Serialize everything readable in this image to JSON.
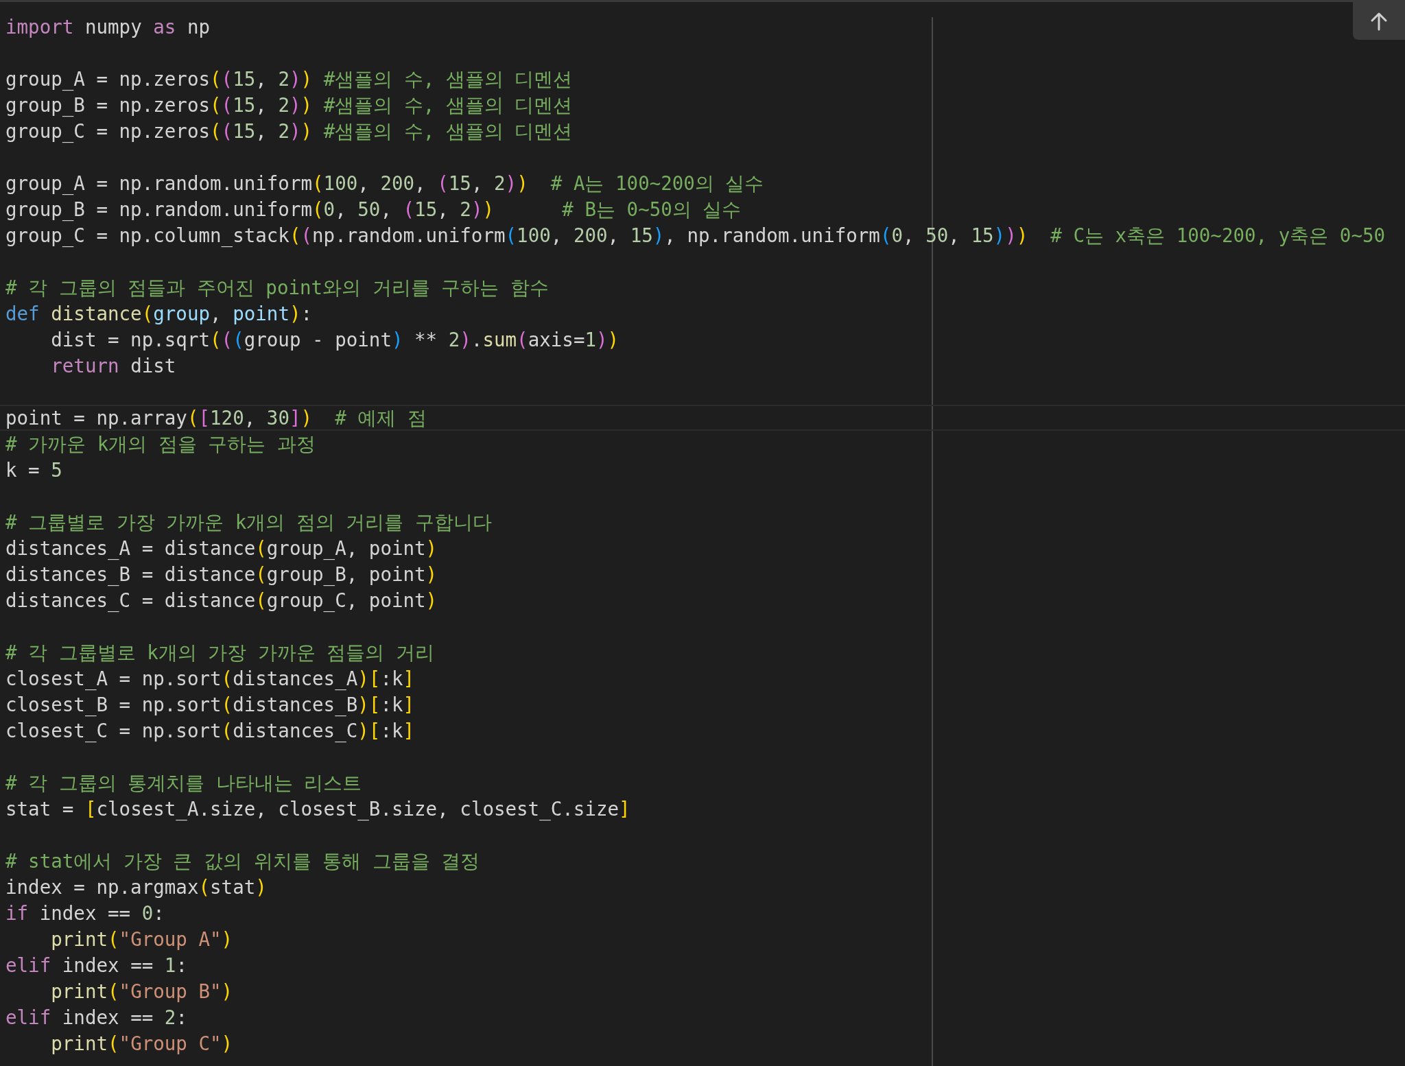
{
  "code": {
    "blocks": [
      {
        "lines": [
          {
            "current": false,
            "tokens": [
              {
                "text": "import",
                "kind": "kw"
              },
              {
                "text": " numpy ",
                "kind": "plain"
              },
              {
                "text": "as",
                "kind": "kw"
              },
              {
                "text": " np",
                "kind": "plain"
              }
            ]
          }
        ]
      },
      {
        "lines": [
          {
            "current": false,
            "tokens": [
              {
                "text": "group_A = np.zeros",
                "kind": "plain"
              },
              {
                "text": "(",
                "kind": "b1"
              },
              {
                "text": "(",
                "kind": "b2"
              },
              {
                "text": "15",
                "kind": "num"
              },
              {
                "text": ", ",
                "kind": "plain"
              },
              {
                "text": "2",
                "kind": "num"
              },
              {
                "text": ")",
                "kind": "b2"
              },
              {
                "text": ")",
                "kind": "b1"
              },
              {
                "text": " #샘플의 수, 샘플의 디멘션",
                "kind": "cm"
              }
            ]
          },
          {
            "current": false,
            "tokens": [
              {
                "text": "group_B = np.zeros",
                "kind": "plain"
              },
              {
                "text": "(",
                "kind": "b1"
              },
              {
                "text": "(",
                "kind": "b2"
              },
              {
                "text": "15",
                "kind": "num"
              },
              {
                "text": ", ",
                "kind": "plain"
              },
              {
                "text": "2",
                "kind": "num"
              },
              {
                "text": ")",
                "kind": "b2"
              },
              {
                "text": ")",
                "kind": "b1"
              },
              {
                "text": " #샘플의 수, 샘플의 디멘션",
                "kind": "cm"
              }
            ]
          },
          {
            "current": false,
            "tokens": [
              {
                "text": "group_C = np.zeros",
                "kind": "plain"
              },
              {
                "text": "(",
                "kind": "b1"
              },
              {
                "text": "(",
                "kind": "b2"
              },
              {
                "text": "15",
                "kind": "num"
              },
              {
                "text": ", ",
                "kind": "plain"
              },
              {
                "text": "2",
                "kind": "num"
              },
              {
                "text": ")",
                "kind": "b2"
              },
              {
                "text": ")",
                "kind": "b1"
              },
              {
                "text": " #샘플의 수, 샘플의 디멘션",
                "kind": "cm"
              }
            ]
          }
        ]
      },
      {
        "lines": [
          {
            "current": false,
            "tokens": [
              {
                "text": "group_A = np.random.uniform",
                "kind": "plain"
              },
              {
                "text": "(",
                "kind": "b1"
              },
              {
                "text": "100",
                "kind": "num"
              },
              {
                "text": ", ",
                "kind": "plain"
              },
              {
                "text": "200",
                "kind": "num"
              },
              {
                "text": ", ",
                "kind": "plain"
              },
              {
                "text": "(",
                "kind": "b2"
              },
              {
                "text": "15",
                "kind": "num"
              },
              {
                "text": ", ",
                "kind": "plain"
              },
              {
                "text": "2",
                "kind": "num"
              },
              {
                "text": ")",
                "kind": "b2"
              },
              {
                "text": ")",
                "kind": "b1"
              },
              {
                "text": "  # A는 100~200의 실수",
                "kind": "cm"
              }
            ]
          },
          {
            "current": false,
            "tokens": [
              {
                "text": "group_B = np.random.uniform",
                "kind": "plain"
              },
              {
                "text": "(",
                "kind": "b1"
              },
              {
                "text": "0",
                "kind": "num"
              },
              {
                "text": ", ",
                "kind": "plain"
              },
              {
                "text": "50",
                "kind": "num"
              },
              {
                "text": ", ",
                "kind": "plain"
              },
              {
                "text": "(",
                "kind": "b2"
              },
              {
                "text": "15",
                "kind": "num"
              },
              {
                "text": ", ",
                "kind": "plain"
              },
              {
                "text": "2",
                "kind": "num"
              },
              {
                "text": ")",
                "kind": "b2"
              },
              {
                "text": ")",
                "kind": "b1"
              },
              {
                "text": "      # B는 0~50의 실수",
                "kind": "cm"
              }
            ]
          },
          {
            "current": false,
            "tokens": [
              {
                "text": "group_C = np.column_stack",
                "kind": "plain"
              },
              {
                "text": "(",
                "kind": "b1"
              },
              {
                "text": "(",
                "kind": "b2"
              },
              {
                "text": "np.random.uniform",
                "kind": "plain"
              },
              {
                "text": "(",
                "kind": "b3"
              },
              {
                "text": "100",
                "kind": "num"
              },
              {
                "text": ", ",
                "kind": "plain"
              },
              {
                "text": "200",
                "kind": "num"
              },
              {
                "text": ", ",
                "kind": "plain"
              },
              {
                "text": "15",
                "kind": "num"
              },
              {
                "text": ")",
                "kind": "b3"
              },
              {
                "text": ", np.random.uniform",
                "kind": "plain"
              },
              {
                "text": "(",
                "kind": "b3"
              },
              {
                "text": "0",
                "kind": "num"
              },
              {
                "text": ", ",
                "kind": "plain"
              },
              {
                "text": "50",
                "kind": "num"
              },
              {
                "text": ", ",
                "kind": "plain"
              },
              {
                "text": "15",
                "kind": "num"
              },
              {
                "text": ")",
                "kind": "b3"
              },
              {
                "text": ")",
                "kind": "b2"
              },
              {
                "text": ")",
                "kind": "b1"
              },
              {
                "text": "  # C는 x축은 100~200, y축은 0~50",
                "kind": "cm"
              }
            ]
          }
        ]
      },
      {
        "lines": [
          {
            "current": false,
            "tokens": [
              {
                "text": "# 각 그룹의 점들과 주어진 point와의 거리를 구하는 함수",
                "kind": "cm"
              }
            ]
          },
          {
            "current": false,
            "tokens": [
              {
                "text": "def",
                "kind": "def"
              },
              {
                "text": " distance",
                "kind": "fn"
              },
              {
                "text": "(",
                "kind": "b1"
              },
              {
                "text": "group",
                "kind": "param"
              },
              {
                "text": ", ",
                "kind": "plain"
              },
              {
                "text": "point",
                "kind": "param"
              },
              {
                "text": ")",
                "kind": "b1"
              },
              {
                "text": ":",
                "kind": "plain"
              }
            ]
          },
          {
            "current": false,
            "tokens": [
              {
                "text": "    dist = np.sqrt",
                "kind": "plain"
              },
              {
                "text": "(",
                "kind": "b1"
              },
              {
                "text": "(",
                "kind": "b2"
              },
              {
                "text": "(",
                "kind": "b3"
              },
              {
                "text": "group - point",
                "kind": "plain"
              },
              {
                "text": ")",
                "kind": "b3"
              },
              {
                "text": " ** ",
                "kind": "plain"
              },
              {
                "text": "2",
                "kind": "num"
              },
              {
                "text": ")",
                "kind": "b2"
              },
              {
                "text": ".",
                "kind": "plain"
              },
              {
                "text": "sum",
                "kind": "fn"
              },
              {
                "text": "(",
                "kind": "b2"
              },
              {
                "text": "axis=",
                "kind": "plain"
              },
              {
                "text": "1",
                "kind": "num"
              },
              {
                "text": ")",
                "kind": "b2"
              },
              {
                "text": ")",
                "kind": "b1"
              }
            ]
          },
          {
            "current": false,
            "tokens": [
              {
                "text": "    return",
                "kind": "kw"
              },
              {
                "text": " dist",
                "kind": "plain"
              }
            ]
          }
        ]
      },
      {
        "lines": [
          {
            "current": true,
            "tokens": [
              {
                "text": "point = np.array",
                "kind": "plain"
              },
              {
                "text": "(",
                "kind": "b1"
              },
              {
                "text": "[",
                "kind": "b2"
              },
              {
                "text": "120",
                "kind": "num"
              },
              {
                "text": ", ",
                "kind": "plain"
              },
              {
                "text": "30",
                "kind": "num"
              },
              {
                "text": "]",
                "kind": "b2"
              },
              {
                "text": ")",
                "kind": "b1"
              },
              {
                "text": "  # 예제 점",
                "kind": "cm"
              }
            ]
          },
          {
            "current": false,
            "tokens": [
              {
                "text": "# 가까운 k개의 점을 구하는 과정",
                "kind": "cm"
              }
            ]
          },
          {
            "current": false,
            "tokens": [
              {
                "text": "k = ",
                "kind": "plain"
              },
              {
                "text": "5",
                "kind": "num"
              }
            ]
          }
        ]
      },
      {
        "lines": [
          {
            "current": false,
            "tokens": [
              {
                "text": "# 그룹별로 가장 가까운 k개의 점의 거리를 구합니다",
                "kind": "cm"
              }
            ]
          },
          {
            "current": false,
            "tokens": [
              {
                "text": "distances_A = distance",
                "kind": "plain"
              },
              {
                "text": "(",
                "kind": "b1"
              },
              {
                "text": "group_A, point",
                "kind": "plain"
              },
              {
                "text": ")",
                "kind": "b1"
              }
            ]
          },
          {
            "current": false,
            "tokens": [
              {
                "text": "distances_B = distance",
                "kind": "plain"
              },
              {
                "text": "(",
                "kind": "b1"
              },
              {
                "text": "group_B, point",
                "kind": "plain"
              },
              {
                "text": ")",
                "kind": "b1"
              }
            ]
          },
          {
            "current": false,
            "tokens": [
              {
                "text": "distances_C = distance",
                "kind": "plain"
              },
              {
                "text": "(",
                "kind": "b1"
              },
              {
                "text": "group_C, point",
                "kind": "plain"
              },
              {
                "text": ")",
                "kind": "b1"
              }
            ]
          }
        ]
      },
      {
        "lines": [
          {
            "current": false,
            "tokens": [
              {
                "text": "# 각 그룹별로 k개의 가장 가까운 점들의 거리",
                "kind": "cm"
              }
            ]
          },
          {
            "current": false,
            "tokens": [
              {
                "text": "closest_A = np.sort",
                "kind": "plain"
              },
              {
                "text": "(",
                "kind": "b1"
              },
              {
                "text": "distances_A",
                "kind": "plain"
              },
              {
                "text": ")",
                "kind": "b1"
              },
              {
                "text": "[",
                "kind": "b1"
              },
              {
                "text": ":k",
                "kind": "plain"
              },
              {
                "text": "]",
                "kind": "b1"
              }
            ]
          },
          {
            "current": false,
            "tokens": [
              {
                "text": "closest_B = np.sort",
                "kind": "plain"
              },
              {
                "text": "(",
                "kind": "b1"
              },
              {
                "text": "distances_B",
                "kind": "plain"
              },
              {
                "text": ")",
                "kind": "b1"
              },
              {
                "text": "[",
                "kind": "b1"
              },
              {
                "text": ":k",
                "kind": "plain"
              },
              {
                "text": "]",
                "kind": "b1"
              }
            ]
          },
          {
            "current": false,
            "tokens": [
              {
                "text": "closest_C = np.sort",
                "kind": "plain"
              },
              {
                "text": "(",
                "kind": "b1"
              },
              {
                "text": "distances_C",
                "kind": "plain"
              },
              {
                "text": ")",
                "kind": "b1"
              },
              {
                "text": "[",
                "kind": "b1"
              },
              {
                "text": ":k",
                "kind": "plain"
              },
              {
                "text": "]",
                "kind": "b1"
              }
            ]
          }
        ]
      },
      {
        "lines": [
          {
            "current": false,
            "tokens": [
              {
                "text": "# 각 그룹의 통계치를 나타내는 리스트",
                "kind": "cm"
              }
            ]
          },
          {
            "current": false,
            "tokens": [
              {
                "text": "stat = ",
                "kind": "plain"
              },
              {
                "text": "[",
                "kind": "b1"
              },
              {
                "text": "closest_A.size, closest_B.size, closest_C.size",
                "kind": "plain"
              },
              {
                "text": "]",
                "kind": "b1"
              }
            ]
          }
        ]
      },
      {
        "lines": [
          {
            "current": false,
            "tokens": [
              {
                "text": "# stat에서 가장 큰 값의 위치를 통해 그룹을 결정",
                "kind": "cm"
              }
            ]
          },
          {
            "current": false,
            "tokens": [
              {
                "text": "index = np.argmax",
                "kind": "plain"
              },
              {
                "text": "(",
                "kind": "b1"
              },
              {
                "text": "stat",
                "kind": "plain"
              },
              {
                "text": ")",
                "kind": "b1"
              }
            ]
          },
          {
            "current": false,
            "tokens": [
              {
                "text": "if",
                "kind": "kw"
              },
              {
                "text": " index == ",
                "kind": "plain"
              },
              {
                "text": "0",
                "kind": "num"
              },
              {
                "text": ":",
                "kind": "plain"
              }
            ]
          },
          {
            "current": false,
            "tokens": [
              {
                "text": "    print",
                "kind": "fn"
              },
              {
                "text": "(",
                "kind": "b1"
              },
              {
                "text": "\"Group A\"",
                "kind": "str"
              },
              {
                "text": ")",
                "kind": "b1"
              }
            ]
          },
          {
            "current": false,
            "tokens": [
              {
                "text": "elif",
                "kind": "kw"
              },
              {
                "text": " index == ",
                "kind": "plain"
              },
              {
                "text": "1",
                "kind": "num"
              },
              {
                "text": ":",
                "kind": "plain"
              }
            ]
          },
          {
            "current": false,
            "tokens": [
              {
                "text": "    print",
                "kind": "fn"
              },
              {
                "text": "(",
                "kind": "b1"
              },
              {
                "text": "\"Group B\"",
                "kind": "str"
              },
              {
                "text": ")",
                "kind": "b1"
              }
            ]
          },
          {
            "current": false,
            "tokens": [
              {
                "text": "elif",
                "kind": "kw"
              },
              {
                "text": " index == ",
                "kind": "plain"
              },
              {
                "text": "2",
                "kind": "num"
              },
              {
                "text": ":",
                "kind": "plain"
              }
            ]
          },
          {
            "current": false,
            "tokens": [
              {
                "text": "    print",
                "kind": "fn"
              },
              {
                "text": "(",
                "kind": "b1"
              },
              {
                "text": "\"Group C\"",
                "kind": "str"
              },
              {
                "text": ")",
                "kind": "b1"
              }
            ]
          }
        ]
      }
    ]
  }
}
